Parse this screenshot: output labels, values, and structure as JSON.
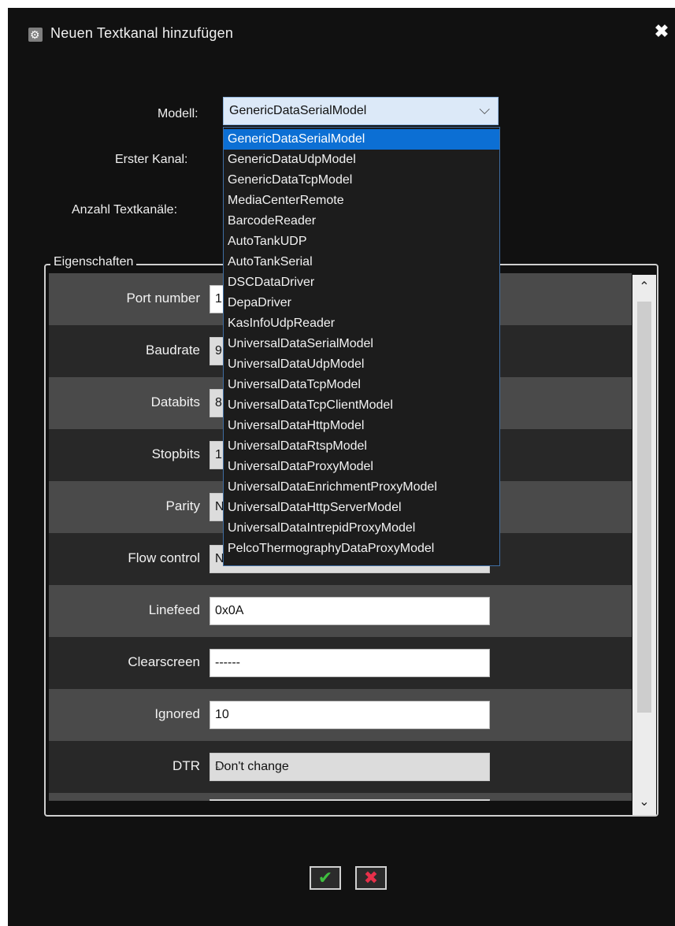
{
  "dialog": {
    "title": "Neuen Textkanal hinzufügen",
    "close_icon": "✖"
  },
  "form": {
    "modell_label": "Modell:",
    "modell_value": "GenericDataSerialModel",
    "erster_kanal_label": "Erster Kanal:",
    "anzahl_label": "Anzahl Textkanäle:"
  },
  "group": {
    "legend": "Eigenschaften"
  },
  "properties": [
    {
      "label": "Port number",
      "value": "1"
    },
    {
      "label": "Baudrate",
      "value": "9"
    },
    {
      "label": "Databits",
      "value": "8"
    },
    {
      "label": "Stopbits",
      "value": "1"
    },
    {
      "label": "Parity",
      "value": "N"
    },
    {
      "label": "Flow control",
      "value": "N"
    },
    {
      "label": "Linefeed",
      "value": "0x0A"
    },
    {
      "label": "Clearscreen",
      "value": "------"
    },
    {
      "label": "Ignored",
      "value": "10"
    },
    {
      "label": "DTR",
      "value": "Don't change"
    }
  ],
  "dropdown": {
    "selected_index": 0,
    "items": [
      "GenericDataSerialModel",
      "GenericDataUdpModel",
      "GenericDataTcpModel",
      "MediaCenterRemote",
      "BarcodeReader",
      "AutoTankUDP",
      "AutoTankSerial",
      "DSCDataDriver",
      "DepaDriver",
      "KasInfoUdpReader",
      "UniversalDataSerialModel",
      "UniversalDataUdpModel",
      "UniversalDataTcpModel",
      "UniversalDataTcpClientModel",
      "UniversalDataHttpModel",
      "UniversalDataRtspModel",
      "UniversalDataProxyModel",
      "UniversalDataEnrichmentProxyModel",
      "UniversalDataHttpServerModel",
      "UniversalDataIntrepidProxyModel",
      "PelcoThermographyDataProxyModel"
    ]
  },
  "buttons": {
    "ok_icon": "✔",
    "cancel_icon": "✖"
  },
  "colors": {
    "background": "#111111",
    "selection": "#0c6fd4",
    "ok": "#3fbf3f",
    "cancel": "#e8304a"
  }
}
